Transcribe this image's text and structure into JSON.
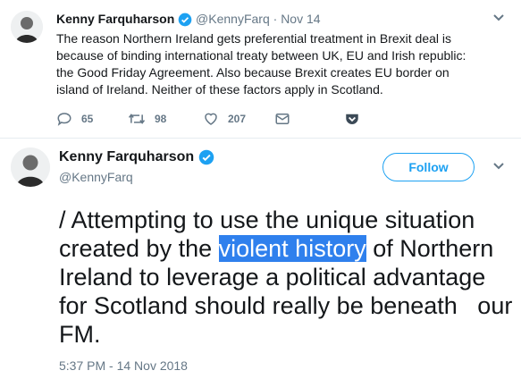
{
  "tweet1": {
    "name": "Kenny Farquharson",
    "handle": "@KennyFarq",
    "sep": "·",
    "date": "Nov 14",
    "text": "The reason Northern Ireland gets preferential treatment in Brexit deal is because of binding international treaty between UK, EU and Irish republic: the Good Friday Agreement. Also because Brexit creates EU border on island of Ireland. Neither of these factors apply in Scotland.",
    "replies": "65",
    "retweets": "98",
    "likes": "207"
  },
  "tweet2": {
    "name": "Kenny Farquharson",
    "handle": "@KennyFarq",
    "follow_label": "Follow",
    "text_before": "/ Attempting to use the unique situation created by the ",
    "text_highlight": "violent history",
    "text_after": " of Northern Ireland to leverage a political advantage for Scotland should really be beneath   our FM.",
    "timestamp": "5:37 PM - 14 Nov 2018"
  },
  "colors": {
    "accent": "#1da1f2",
    "selection": "#2f80ed",
    "muted": "#657786"
  }
}
